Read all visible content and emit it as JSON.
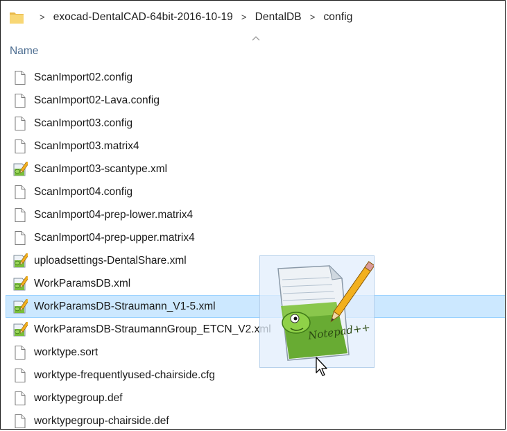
{
  "breadcrumb": {
    "items": [
      {
        "label": "exocad-DentalCAD-64bit-2016-10-19"
      },
      {
        "label": "DentalDB"
      },
      {
        "label": "config"
      }
    ]
  },
  "columns": {
    "name_label": "Name"
  },
  "files": [
    {
      "name": "ScanImport02.config",
      "icon": "document-icon"
    },
    {
      "name": "ScanImport02-Lava.config",
      "icon": "document-icon"
    },
    {
      "name": "ScanImport03.config",
      "icon": "document-icon"
    },
    {
      "name": "ScanImport03.matrix4",
      "icon": "document-icon"
    },
    {
      "name": "ScanImport03-scantype.xml",
      "icon": "notepadpp-file-icon"
    },
    {
      "name": "ScanImport04.config",
      "icon": "document-icon"
    },
    {
      "name": "ScanImport04-prep-lower.matrix4",
      "icon": "document-icon"
    },
    {
      "name": "ScanImport04-prep-upper.matrix4",
      "icon": "document-icon"
    },
    {
      "name": "uploadsettings-DentalShare.xml",
      "icon": "notepadpp-file-icon"
    },
    {
      "name": "WorkParamsDB.xml",
      "icon": "notepadpp-file-icon"
    },
    {
      "name": "WorkParamsDB-Straumann_V1-5.xml",
      "icon": "notepadpp-file-icon",
      "selected": true
    },
    {
      "name": "WorkParamsDB-StraumannGroup_ETCN_V2.xml",
      "icon": "notepadpp-file-icon"
    },
    {
      "name": "worktype.sort",
      "icon": "document-icon"
    },
    {
      "name": "worktype-frequentlyused-chairside.cfg",
      "icon": "document-icon"
    },
    {
      "name": "worktypegroup.def",
      "icon": "document-icon"
    },
    {
      "name": "worktypegroup-chairside.def",
      "icon": "document-icon"
    }
  ],
  "drag_ghost": {
    "app_icon": "notepadpp-app-icon",
    "logo_text": "Notepad++"
  },
  "colors": {
    "selection_bg": "#cce8ff",
    "selection_border": "#99d1ff",
    "header_text": "#4a6b8f",
    "folder_yellow": "#f8d775"
  }
}
